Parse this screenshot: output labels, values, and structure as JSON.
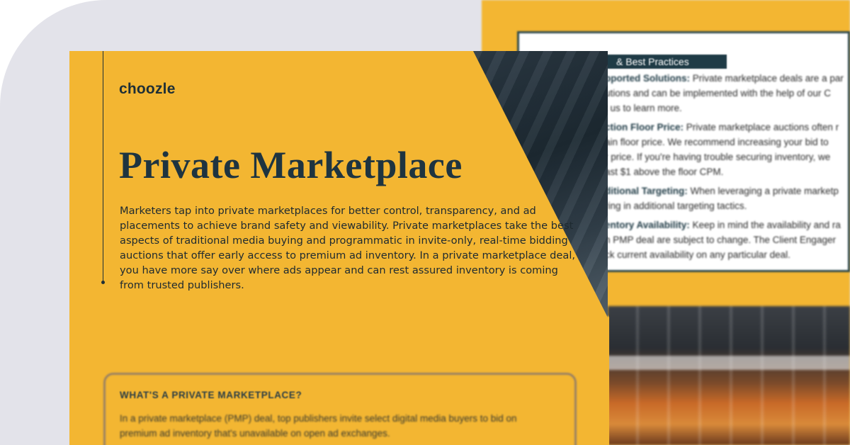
{
  "brand": {
    "logo_text": "choozle",
    "primary_color": "#f3b632",
    "dark_color": "#1e3440"
  },
  "front_page": {
    "title": "Private Marketplace",
    "description_lines": [
      "Marketers tap into private marketplaces for better control, transparency, and ad",
      "placements to achieve brand safety and viewability. Private marketplaces take the best",
      "aspects of traditional media buying and programmatic in invite-only, real-time bidding",
      "auctions that offer early access to premium ad inventory. In a private marketplace deal,",
      "you have more say over where ads appear and can rest assured inventory is coming",
      "from trusted publishers."
    ],
    "callout": {
      "heading": "WHAT'S A PRIVATE MARKETPLACE?",
      "lines": [
        "In a private marketplace (PMP) deal, top publishers invite select digital media buyers to bid on",
        "premium ad inventory that's unavailable on open ad exchanges."
      ]
    }
  },
  "back_page": {
    "header": "& Best Practices",
    "items": [
      {
        "label": "pported Solutions:",
        "lines": [
          " Private marketplace deals are a par",
          "utions and can be implemented with the help of our C",
          "t us to learn more."
        ]
      },
      {
        "label": "ction Floor Price:",
        "lines": [
          " Private marketplace auctions often r",
          "ain floor price. We recommend increasing your bid to",
          "r price. If you're having trouble securing inventory, we",
          "ast $1 above the floor CPM."
        ]
      },
      {
        "label": "ditional Targeting:",
        "lines": [
          " When leveraging a private marketp",
          "ring in additional targeting tactics."
        ]
      },
      {
        "label": "entory Availability:",
        "lines": [
          " Keep in mind the availability and ra",
          "h PMP deal are subject to change. The Client Engager",
          "ck current availability on any particular deal."
        ]
      }
    ]
  }
}
